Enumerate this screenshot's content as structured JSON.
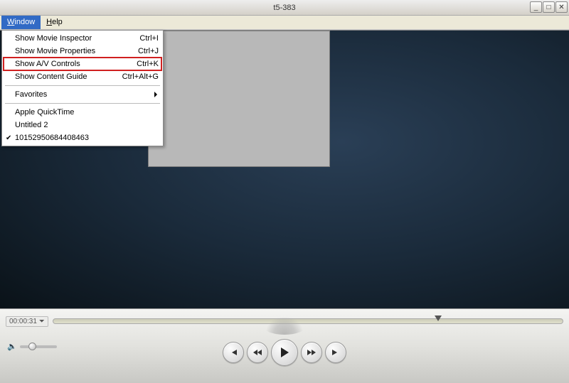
{
  "titlebar": {
    "title": "t5-383",
    "min_label": "minimize",
    "max_label": "maximize",
    "close_label": "close"
  },
  "menubar": {
    "window": {
      "label": "Window",
      "ul": "W"
    },
    "help": {
      "label": "Help",
      "ul": "H"
    }
  },
  "dropdown": {
    "items": [
      {
        "label": "Show Movie Inspector",
        "shortcut": "Ctrl+I",
        "highlight": false
      },
      {
        "label": "Show Movie Properties",
        "shortcut": "Ctrl+J",
        "highlight": false
      },
      {
        "label": "Show A/V Controls",
        "shortcut": "Ctrl+K",
        "highlight": true
      },
      {
        "label": "Show Content Guide",
        "shortcut": "Ctrl+Alt+G",
        "highlight": false
      }
    ],
    "favorites_label": "Favorites",
    "windows": [
      {
        "label": "Apple QuickTime",
        "checked": false
      },
      {
        "label": "Untitled 2",
        "checked": false
      },
      {
        "label": "10152950684408463",
        "checked": true
      }
    ]
  },
  "player": {
    "time": "00:00:31",
    "suffix": "⏷"
  },
  "icons": {
    "prev_label": "previous",
    "rw_label": "rewind",
    "play_label": "play",
    "ff_label": "fast-forward",
    "next_label": "next"
  }
}
